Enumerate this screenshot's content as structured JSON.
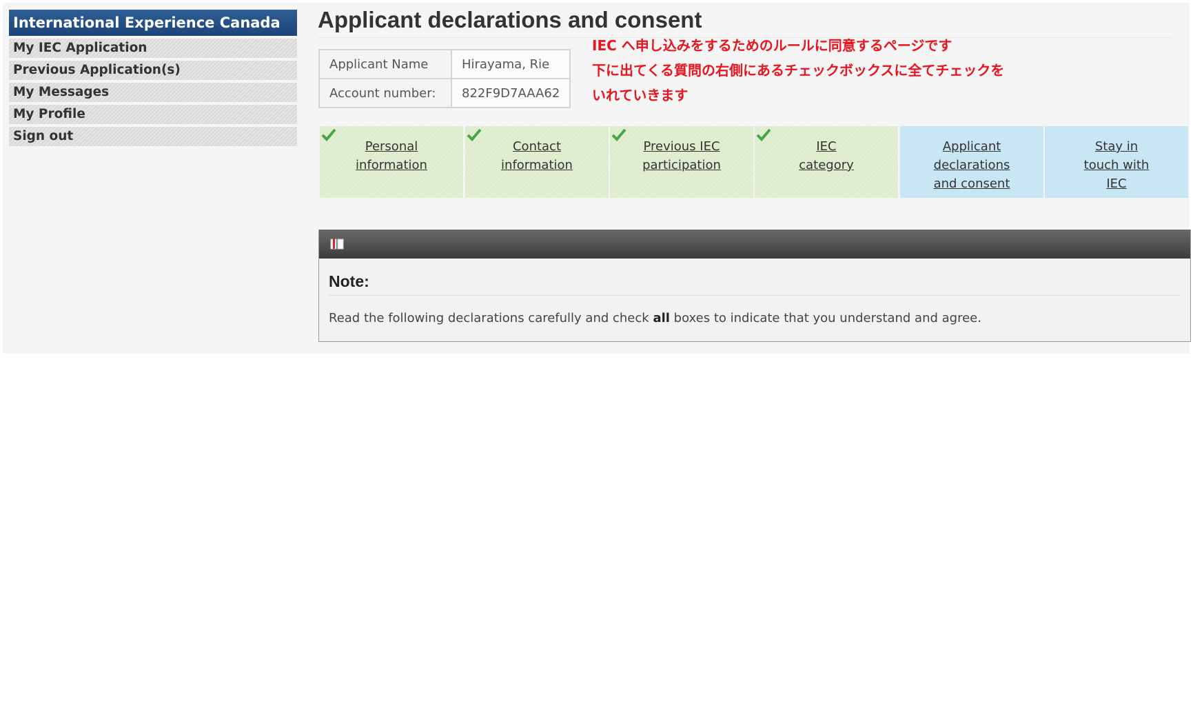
{
  "sidebar": {
    "title": "International Experience Canada",
    "items": [
      {
        "label": "My IEC Application"
      },
      {
        "label": "Previous Application(s)"
      },
      {
        "label": "My Messages"
      },
      {
        "label": "My Profile"
      },
      {
        "label": "Sign out"
      }
    ]
  },
  "main": {
    "title": "Applicant declarations and consent",
    "info": {
      "name_label": "Applicant Name",
      "name_value": "Hirayama, Rie",
      "account_label": "Account number:",
      "account_value": "822F9D7AAA62"
    },
    "annotations": [
      "IEC へ申し込みをするためのルールに同意するページです",
      "下に出てくる質問の右側にあるチェックボックスに全てチェックを",
      "いれていきます"
    ],
    "steps": [
      {
        "label": "Personal information",
        "completed": true
      },
      {
        "label": "Contact information",
        "completed": true
      },
      {
        "label": "Previous IEC participation",
        "completed": true
      },
      {
        "label": "IEC category",
        "completed": true
      },
      {
        "label": "Applicant declarations and consent",
        "completed": false
      },
      {
        "label": "Stay in touch with IEC",
        "completed": false
      }
    ],
    "note": {
      "title": "Note:",
      "text_before": "Read the following declarations carefully and check ",
      "text_bold": "all",
      "text_after": " boxes to indicate that you understand and agree."
    }
  },
  "colors": {
    "sidebar_header": "#1d4478",
    "step_done": "#dcebc9",
    "step_todo": "#c8e6f4",
    "annotation": "#e8141e",
    "check": "#4aa54a"
  },
  "icons": {
    "step_check": "check-icon",
    "note": "book-icon"
  }
}
